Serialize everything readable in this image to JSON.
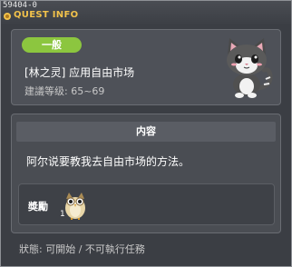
{
  "window": {
    "quest_id": "59404-0",
    "title": "QUEST INFO"
  },
  "quest": {
    "category": "一般",
    "name": "[林之灵] 应用自由市场",
    "level": "建議等级: 65~69"
  },
  "content": {
    "header": "内容",
    "text": "阿尔说要教我去自由市场的方法。"
  },
  "reward": {
    "label": "奬勵",
    "item_icon": "owl-icon",
    "item_count": "1"
  },
  "status": "狀態: 可開始 / 不可執行任務",
  "colors": {
    "title": "#f2c24b",
    "badge": "#8cc63f",
    "panel": "#4e5158",
    "background": "#3b3e44"
  }
}
